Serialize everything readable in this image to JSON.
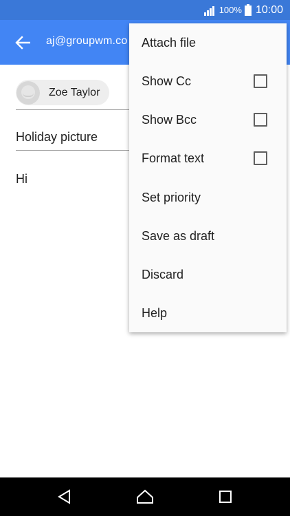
{
  "status_bar": {
    "battery_percent": "100%",
    "time": "10:00",
    "icons": [
      "signal-icon",
      "battery-icon"
    ]
  },
  "app_bar": {
    "account_email": "aj@groupwm.co",
    "icons": [
      "back-arrow-icon"
    ]
  },
  "compose": {
    "recipient_name": "Zoe Taylor",
    "subject": "Holiday picture",
    "body": "Hi"
  },
  "menu": {
    "items": [
      {
        "label": "Attach file"
      },
      {
        "label": "Show Cc",
        "checked": false
      },
      {
        "label": "Show Bcc",
        "checked": false
      },
      {
        "label": "Format text",
        "checked": false
      },
      {
        "label": "Set priority"
      },
      {
        "label": "Save as draft"
      },
      {
        "label": "Discard"
      },
      {
        "label": "Help"
      }
    ]
  },
  "nav_bar": {
    "icons": [
      "nav-back-icon",
      "nav-home-icon",
      "nav-recents-icon"
    ]
  },
  "colors": {
    "status_bar": "#3a78d8",
    "app_bar": "#4285f4",
    "menu_background": "#fafafa"
  }
}
